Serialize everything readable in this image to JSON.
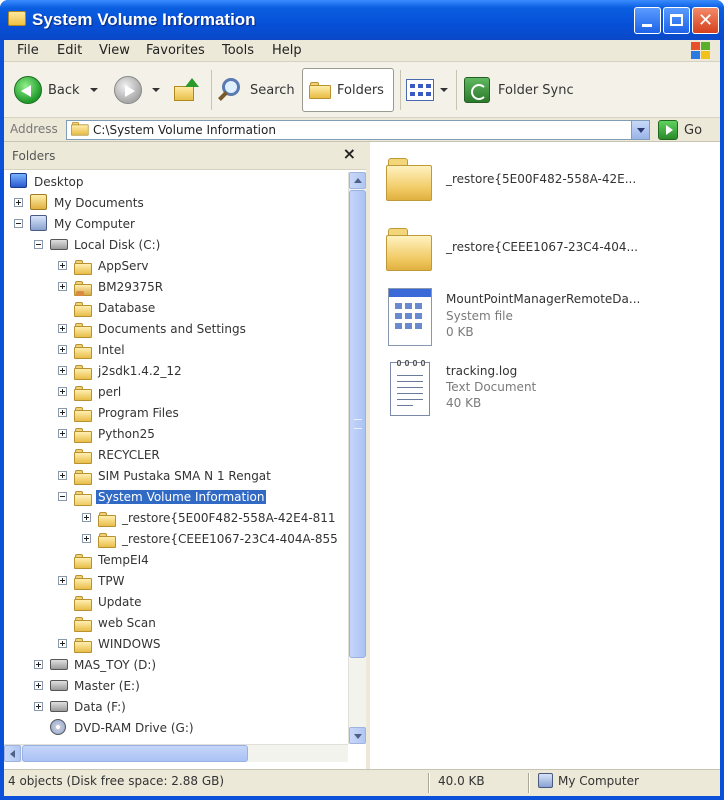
{
  "window": {
    "title": "System Volume Information"
  },
  "menu": [
    "File",
    "Edit",
    "View",
    "Favorites",
    "Tools",
    "Help"
  ],
  "toolbar": {
    "back_label": "Back",
    "search_label": "Search",
    "folders_label": "Folders",
    "folder_sync_label": "Folder Sync"
  },
  "address": {
    "label": "Address",
    "value": "C:\\System Volume Information",
    "go_label": "Go"
  },
  "folders_pane": {
    "title": "Folders",
    "close_glyph": "×",
    "tree": [
      {
        "label": "Desktop",
        "icon": "desktop-icon",
        "expander": "none"
      },
      {
        "label": "My Documents",
        "icon": "my-documents-icon",
        "expander": "plus"
      },
      {
        "label": "My Computer",
        "icon": "computer-icon",
        "expander": "minus"
      },
      {
        "label": "Local Disk (C:)",
        "icon": "drive-icon",
        "expander": "minus"
      },
      {
        "label": "AppServ",
        "icon": "folder-icon",
        "expander": "plus"
      },
      {
        "label": "BM29375R",
        "icon": "shared-folder-icon",
        "expander": "plus"
      },
      {
        "label": "Database",
        "icon": "folder-icon",
        "expander": "none"
      },
      {
        "label": "Documents and Settings",
        "icon": "folder-icon",
        "expander": "plus"
      },
      {
        "label": "Intel",
        "icon": "folder-icon",
        "expander": "plus"
      },
      {
        "label": "j2sdk1.4.2_12",
        "icon": "folder-icon",
        "expander": "plus"
      },
      {
        "label": "perl",
        "icon": "folder-icon",
        "expander": "plus"
      },
      {
        "label": "Program Files",
        "icon": "folder-icon",
        "expander": "plus"
      },
      {
        "label": "Python25",
        "icon": "folder-icon",
        "expander": "plus"
      },
      {
        "label": "RECYCLER",
        "icon": "folder-icon",
        "expander": "none"
      },
      {
        "label": "SIM Pustaka SMA N 1 Rengat",
        "icon": "folder-icon",
        "expander": "plus"
      },
      {
        "label": "System Volume Information",
        "icon": "open-folder-icon",
        "expander": "minus",
        "selected": true
      },
      {
        "label": "_restore{5E00F482-558A-42E4-811",
        "icon": "folder-icon",
        "expander": "plus"
      },
      {
        "label": "_restore{CEEE1067-23C4-404A-855",
        "icon": "folder-icon",
        "expander": "plus"
      },
      {
        "label": "TempEI4",
        "icon": "folder-icon",
        "expander": "none"
      },
      {
        "label": "TPW",
        "icon": "folder-icon",
        "expander": "plus"
      },
      {
        "label": "Update",
        "icon": "folder-icon",
        "expander": "none"
      },
      {
        "label": "web Scan",
        "icon": "folder-icon",
        "expander": "none"
      },
      {
        "label": "WINDOWS",
        "icon": "folder-icon",
        "expander": "plus"
      },
      {
        "label": "MAS_TOY (D:)",
        "icon": "drive-icon",
        "expander": "plus"
      },
      {
        "label": "Master (E:)",
        "icon": "drive-icon",
        "expander": "plus"
      },
      {
        "label": "Data (F:)",
        "icon": "drive-icon",
        "expander": "plus"
      },
      {
        "label": "DVD-RAM Drive (G:)",
        "icon": "cd-drive-icon",
        "expander": "none"
      }
    ]
  },
  "files": [
    {
      "name": "_restore{5E00F482-558A-42E...",
      "type": "",
      "size": "",
      "icon": "folder-icon"
    },
    {
      "name": "_restore{CEEE1067-23C4-404...",
      "type": "",
      "size": "",
      "icon": "folder-icon"
    },
    {
      "name": "MountPointManagerRemoteDa...",
      "type": "System file",
      "size": "0 KB",
      "icon": "system-file-icon"
    },
    {
      "name": "tracking.log",
      "type": "Text Document",
      "size": "40 KB",
      "icon": "text-document-icon"
    }
  ],
  "status": {
    "objects": "4 objects (Disk free space: 2.88 GB)",
    "size": "40.0 KB",
    "location": "My Computer"
  }
}
